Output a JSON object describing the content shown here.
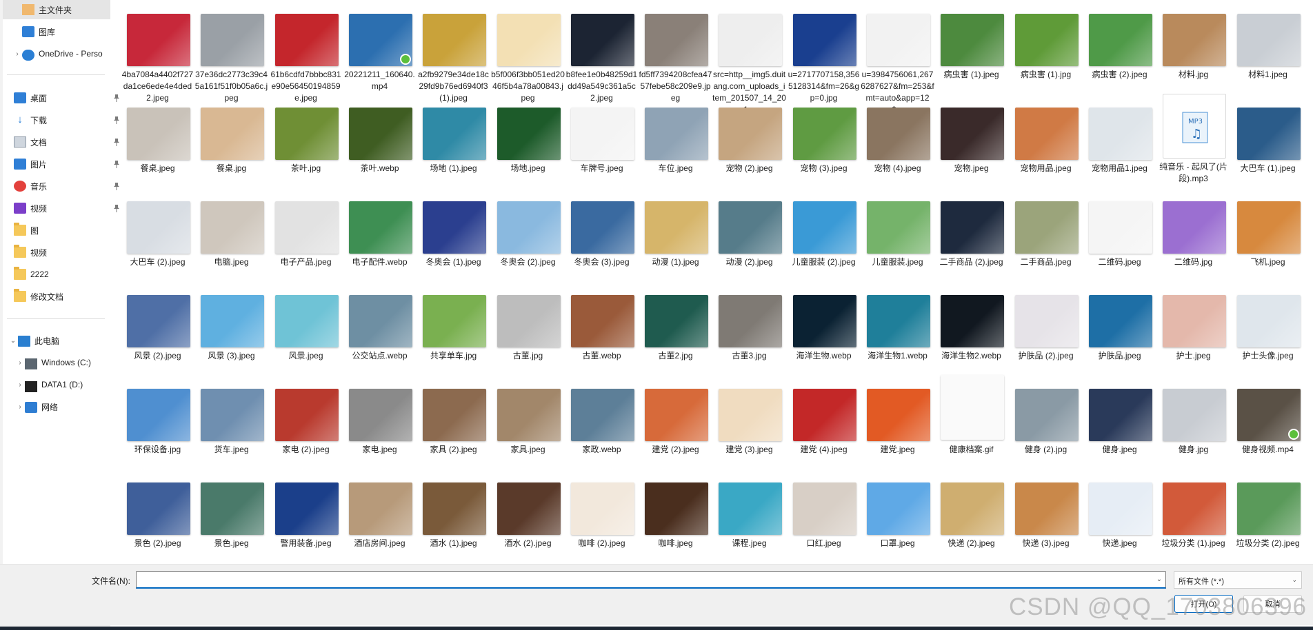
{
  "nav": {
    "items": [
      {
        "label": "主文件夹",
        "icon": "home-folder-icon",
        "expand": "",
        "pin": false,
        "selected": true
      },
      {
        "label": "图库",
        "icon": "gallery-icon",
        "expand": "",
        "pin": false
      },
      {
        "label": "OneDrive - Perso",
        "icon": "cloud-icon",
        "expand": "›",
        "pin": false
      },
      {
        "label": "桌面",
        "icon": "desktop-icon",
        "expand": "",
        "pin": true
      },
      {
        "label": "下载",
        "icon": "download-icon",
        "expand": "",
        "pin": true
      },
      {
        "label": "文档",
        "icon": "document-icon",
        "expand": "",
        "pin": true
      },
      {
        "label": "图片",
        "icon": "pictures-icon",
        "expand": "",
        "pin": true
      },
      {
        "label": "音乐",
        "icon": "music-icon",
        "expand": "",
        "pin": true
      },
      {
        "label": "视频",
        "icon": "video-icon",
        "expand": "",
        "pin": true
      },
      {
        "label": "图",
        "icon": "folder-icon",
        "expand": "",
        "pin": false
      },
      {
        "label": "视频",
        "icon": "folder-icon",
        "expand": "",
        "pin": false
      },
      {
        "label": "2222",
        "icon": "folder-icon",
        "expand": "",
        "pin": false
      },
      {
        "label": "修改文档",
        "icon": "folder-icon",
        "expand": "",
        "pin": false
      },
      {
        "label": "此电脑",
        "icon": "this-pc-icon",
        "expand": "⌄",
        "pin": false
      },
      {
        "label": "Windows (C:)",
        "icon": "drive-c-icon",
        "expand": "›",
        "pin": false
      },
      {
        "label": "DATA1 (D:)",
        "icon": "drive-d-icon",
        "expand": "›",
        "pin": false
      },
      {
        "label": "网络",
        "icon": "network-icon",
        "expand": "›",
        "pin": false
      }
    ]
  },
  "files": [
    [
      "4ba7084a4402f727da1ce6ede4e4ded2.jpeg",
      "37e36dc2773c39c45a161f51f0b05a6c.jpeg",
      "61b6cdfd7bbbc831e90e56450194859e.jpeg",
      "20221211_160640.mp4",
      "a2fb9279e34de18c29fd9b76ed6940f3(1).jpeg",
      "b5f006f3bb051ed2046f5b4a78a00843.jpeg",
      "b8fee1e0b48259d1dd49a549c361a5c2.jpeg",
      "fd5ff7394208cfea4757febe58c209e9.jpeg",
      "src=http__img5.duitang.com_uploads_item_201507_14_201...",
      "u=2717707158,3565128314&fm=26&gp=0.jpg",
      "u=3984756061,2676287627&fm=253&fmt=auto&app=120...",
      "病虫害 (1).jpeg",
      "病虫害 (1).jpg",
      "病虫害 (2).jpeg",
      "材料.jpg",
      "材料1.jpeg"
    ],
    [
      "餐桌.jpeg",
      "餐桌.jpg",
      "茶叶.jpg",
      "茶叶.webp",
      "场地 (1).jpeg",
      "场地.jpeg",
      "车牌号.jpeg",
      "车位.jpeg",
      "宠物 (2).jpeg",
      "宠物 (3).jpeg",
      "宠物 (4).jpeg",
      "宠物.jpeg",
      "宠物用品.jpeg",
      "宠物用品1.jpeg",
      "纯音乐 - 起风了(片段).mp3",
      "大巴车 (1).jpeg"
    ],
    [
      "大巴车 (2).jpeg",
      "电脑.jpeg",
      "电子产品.jpeg",
      "电子配件.webp",
      "冬奥会 (1).jpeg",
      "冬奥会 (2).jpeg",
      "冬奥会 (3).jpeg",
      "动漫 (1).jpeg",
      "动漫 (2).jpeg",
      "儿童服装 (2).jpeg",
      "儿童服装.jpeg",
      "二手商品 (2).jpeg",
      "二手商品.jpeg",
      "二维码.jpeg",
      "二维码.jpg",
      "飞机.jpeg"
    ],
    [
      "风景 (2).jpeg",
      "风景 (3).jpeg",
      "风景.jpeg",
      "公交站点.webp",
      "共享单车.jpg",
      "古董.jpg",
      "古董.webp",
      "古董2.jpg",
      "古董3.jpg",
      "海洋生物.webp",
      "海洋生物1.webp",
      "海洋生物2.webp",
      "护肤品 (2).jpeg",
      "护肤品.jpeg",
      "护士.jpeg",
      "护士头像.jpeg"
    ],
    [
      "环保设备.jpg",
      "货车.jpeg",
      "家电 (2).jpeg",
      "家电.jpeg",
      "家具 (2).jpeg",
      "家具.jpeg",
      "家政.webp",
      "建党 (2).jpeg",
      "建党 (3).jpeg",
      "建党 (4).jpeg",
      "建党.jpeg",
      "健康档案.gif",
      "健身 (2).jpg",
      "健身.jpeg",
      "健身.jpg",
      "健身视频.mp4"
    ],
    [
      "景色 (2).jpeg",
      "景色.jpeg",
      "警用装备.jpeg",
      "酒店房间.jpeg",
      "酒水 (1).jpeg",
      "酒水 (2).jpeg",
      "咖啡 (2).jpeg",
      "咖啡.jpeg",
      "课程.jpeg",
      "口红.jpeg",
      "口罩.jpeg",
      "快递 (2).jpeg",
      "快递 (3).jpeg",
      "快递.jpeg",
      "垃圾分类 (1).jpeg",
      "垃圾分类 (2).jpeg"
    ]
  ],
  "thumb_colors": [
    [
      "#c7283a",
      "#9aa0a6",
      "#c4262c",
      "#2c6fb0",
      "#c9a23a",
      "#f3e0b4",
      "#1c2433",
      "#8a8078",
      "#eeeeee",
      "#1a3f8f",
      "#f2f2f2",
      "#4d8a3e",
      "#5f9b38",
      "#4f9a48",
      "#b98a5c",
      "#c9ced4"
    ],
    [
      "#c9c2b9",
      "#d9b893",
      "#6f8f35",
      "#3f5d22",
      "#2f8aa6",
      "#1d5b2a",
      "#f4f4f4",
      "#8fa3b5",
      "#c5a580",
      "#5f9b42",
      "#8a7560",
      "#3a2a2a",
      "#d07a45",
      "#dfe5ea",
      "#ffffff",
      "#2b5c8a"
    ],
    [
      "#d8dde3",
      "#cfc7bd",
      "#e2e2e2",
      "#3e8f53",
      "#2b3f8f",
      "#8ab9df",
      "#3a6aa0",
      "#d6b56a",
      "#567c8a",
      "#3a9ad6",
      "#75b36a",
      "#1e2a3e",
      "#9ba47b",
      "#f5f5f5",
      "#9b6fd1",
      "#d7893e"
    ],
    [
      "#4f6fa6",
      "#5fb0e0",
      "#6fc3d6",
      "#6e8fa3",
      "#7ab050",
      "#bdbdbd",
      "#9a5a3a",
      "#1f5b4f",
      "#7f7a74",
      "#0b2233",
      "#1f7f9a",
      "#111820",
      "#e6e3e8",
      "#1e6fa6",
      "#e4b8ab",
      "#dfe6ec"
    ],
    [
      "#4f8fd0",
      "#6f8fb0",
      "#b93a2e",
      "#8a8a8a",
      "#8c6a4f",
      "#a2876a",
      "#5d7f98",
      "#d76a3a",
      "#f0dcc0",
      "#c32828",
      "#e25a24",
      "#f4f4f4",
      "#8a9aa5",
      "#2a3a5a",
      "#c8ccd2",
      "#5a5146"
    ],
    [
      "#3f5f9a",
      "#4a7a6a",
      "#1b3f8a",
      "#b79a7a",
      "#7a5a3a",
      "#5a3a2a",
      "#f2e8dc",
      "#4a2e1e",
      "#3aa8c5",
      "#d8cfc6",
      "#5fa9e6",
      "#cfae70",
      "#c9884a",
      "#e6edf5",
      "#d25a3a",
      "#5a9a5a"
    ]
  ],
  "bottom": {
    "filename_label": "文件名(N):",
    "filename_value": "",
    "filetype_value": "所有文件 (*.*)",
    "open_label": "打开(O)",
    "cancel_label": "取消",
    "watermark": "CSDN @QQ_1703806396"
  }
}
